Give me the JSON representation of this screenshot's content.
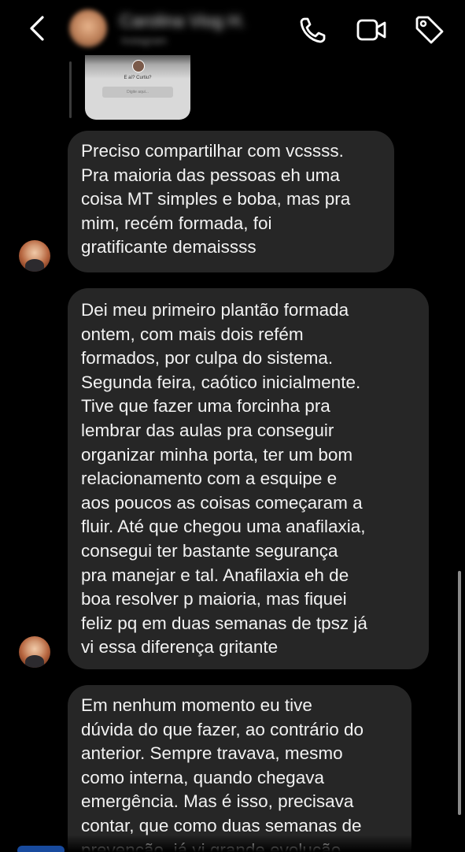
{
  "header": {
    "contact_name": "Carolina Viog H.",
    "contact_status": "Instagram",
    "icons": [
      "back-arrow-icon",
      "phone-icon",
      "video-camera-icon",
      "tag-icon"
    ]
  },
  "reply_story": {
    "question": "E aí? Curtiu?",
    "input_placeholder": "Digite aqui..."
  },
  "messages": [
    {
      "text": "Preciso compartilhar com vcssss.\nPra maioria das pessoas eh uma\ncoisa MT simples e boba, mas pra\nmim, recém formada, foi\ngratificante demaissss"
    },
    {
      "text": "Dei meu primeiro plantão formada\nontem, com mais dois refém\nformados, por culpa do sistema.\nSegunda feira, caótico inicialmente.\nTive que fazer uma forcinha pra\nlembrar das aulas pra conseguir\norganizar minha porta, ter um bom\nrelacionamento com a esquipe e\naos poucos as coisas começaram a\nfluir. Até que chegou uma anafilaxia,\nconsegui ter bastante segurança\npra manejar e tal. Anafilaxia eh de\nboa resolver p maioria, mas fiquei\nfeliz pq em duas semanas de tpsz já\nvi essa diferença gritante"
    },
    {
      "text": "Em nenhum momento eu tive\ndúvida do que fazer, ao contrário do\nanterior. Sempre travava, mesmo\ncomo interna, quando chegava\nemergência. Mas é isso, precisava\ncontar, que como duas semanas de\nprevenção, já vi grande evolução"
    }
  ],
  "colors": {
    "background": "#000000",
    "bubble": "#262626",
    "text": "#f2f2f2"
  }
}
